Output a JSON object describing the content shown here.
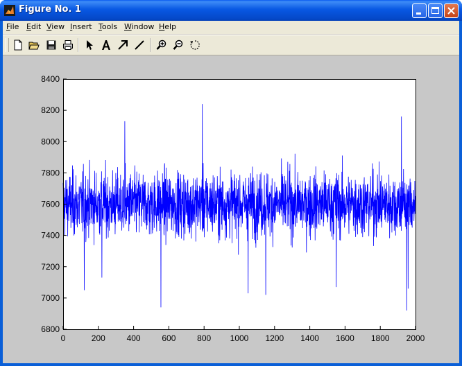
{
  "window": {
    "title": "Figure No. 1",
    "titlebar_color": "#0a5fd8"
  },
  "menu": {
    "items": [
      {
        "label": "File",
        "mnemonic": "F",
        "rest": "ile"
      },
      {
        "label": "Edit",
        "mnemonic": "E",
        "rest": "dit"
      },
      {
        "label": "View",
        "mnemonic": "V",
        "rest": "iew"
      },
      {
        "label": "Insert",
        "mnemonic": "I",
        "rest": "nsert"
      },
      {
        "label": "Tools",
        "mnemonic": "T",
        "rest": "ools"
      },
      {
        "label": "Window",
        "mnemonic": "W",
        "rest": "indow"
      },
      {
        "label": "Help",
        "mnemonic": "H",
        "rest": "elp"
      }
    ]
  },
  "toolbar": {
    "icons": [
      "new-file-icon",
      "open-folder-icon",
      "save-icon",
      "print-icon",
      "select-arrow-icon",
      "text-tool-icon",
      "arrow-tool-icon",
      "line-tool-icon",
      "zoom-in-icon",
      "zoom-out-icon",
      "rotate-3d-icon"
    ]
  },
  "chart_data": {
    "type": "line",
    "title": "",
    "xlabel": "",
    "ylabel": "",
    "xlim": [
      0,
      2000
    ],
    "ylim": [
      6800,
      8400
    ],
    "x_ticks": [
      "0",
      "200",
      "400",
      "600",
      "800",
      "1000",
      "1200",
      "1400",
      "1600",
      "1800",
      "2000"
    ],
    "y_ticks": [
      "6800",
      "7000",
      "7200",
      "7400",
      "7600",
      "7800",
      "8000",
      "8200",
      "8400"
    ],
    "grid": false,
    "line_color": "#0000ff",
    "series": [
      {
        "n_points": 2000,
        "mean": 7600,
        "std": 170,
        "noise": "random",
        "peaks": [
          [
            120,
            7050
          ],
          [
            220,
            7130
          ],
          [
            350,
            8130
          ],
          [
            555,
            6940
          ],
          [
            790,
            8240
          ],
          [
            1050,
            7030
          ],
          [
            1150,
            7020
          ],
          [
            1550,
            7070
          ],
          [
            1920,
            8160
          ],
          [
            1950,
            6920
          ],
          [
            1958,
            7060
          ]
        ]
      }
    ]
  }
}
